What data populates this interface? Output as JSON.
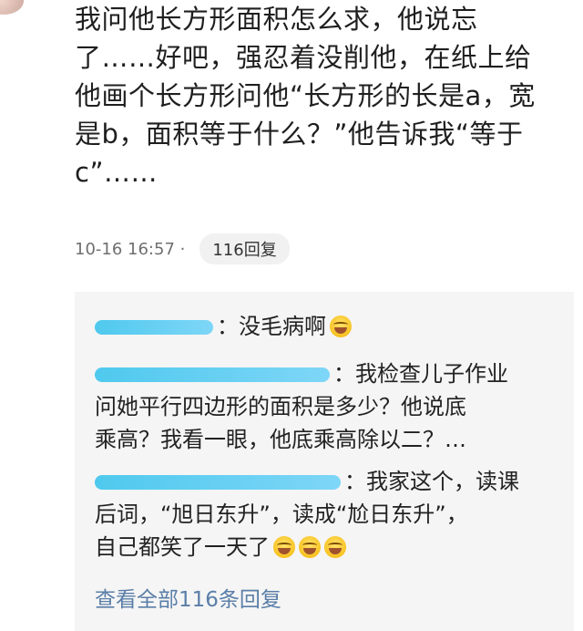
{
  "post": {
    "lines": [
      "我问他长方形面积怎么求，他说忘",
      "了……好吧，强忍着没削他，在纸上给",
      "他画个长方形问他“长方形的长是a，宽",
      "是b，面积等于什么？”他告诉我“等于",
      "c”……"
    ],
    "timestamp": "10-16 16:57 ·",
    "reply_count_label": "116回复"
  },
  "replies": [
    {
      "text_lines": [
        "：没毛病啊"
      ]
    },
    {
      "text_lines": [
        "：我检查儿子作业",
        "问她平行四边形的面积是多少？他说底",
        "乘高？我看一眼，他底乘高除以二？…"
      ]
    },
    {
      "text_lines": [
        "：我家这个，读课",
        "后词，“旭日东升”，读成“尬日东升”，",
        "自己都笑了一天了"
      ]
    }
  ],
  "view_all_label": "查看全部116条回复",
  "colors": {
    "username_blur": "#4fc9ee",
    "link": "#5a7ea8",
    "reply_bg": "#f5f5f5"
  }
}
